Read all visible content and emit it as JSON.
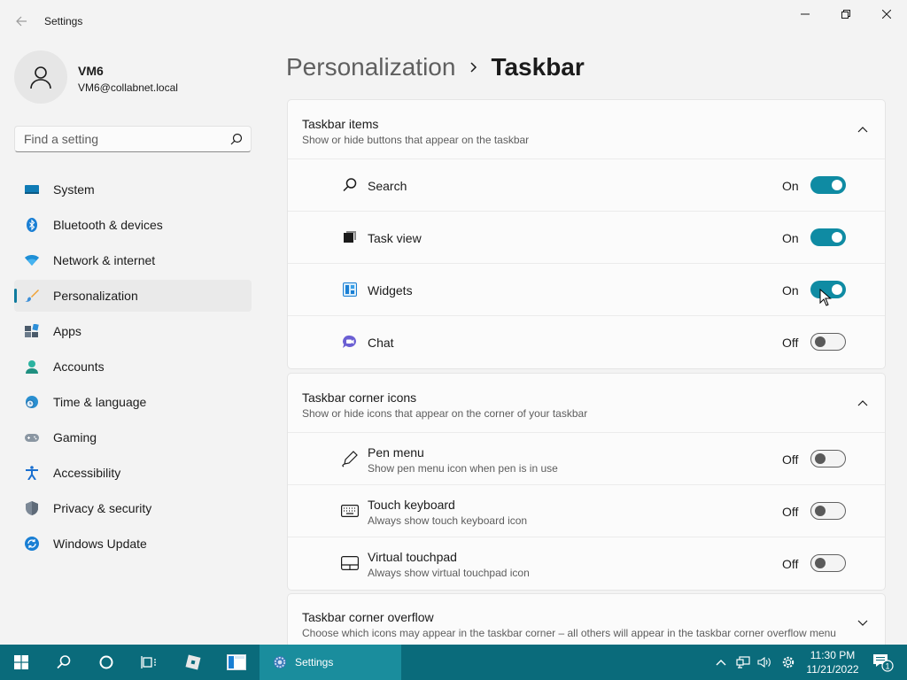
{
  "window": {
    "title": "Settings"
  },
  "user": {
    "name": "VM6",
    "email": "VM6@collabnet.local"
  },
  "search": {
    "placeholder": "Find a setting"
  },
  "nav": [
    {
      "label": "System",
      "icon": "monitor-icon"
    },
    {
      "label": "Bluetooth & devices",
      "icon": "bluetooth-icon"
    },
    {
      "label": "Network & internet",
      "icon": "wifi-icon"
    },
    {
      "label": "Personalization",
      "icon": "brush-icon",
      "active": true
    },
    {
      "label": "Apps",
      "icon": "apps-icon"
    },
    {
      "label": "Accounts",
      "icon": "person-icon"
    },
    {
      "label": "Time & language",
      "icon": "globe-clock-icon"
    },
    {
      "label": "Gaming",
      "icon": "gamepad-icon"
    },
    {
      "label": "Accessibility",
      "icon": "accessibility-icon"
    },
    {
      "label": "Privacy & security",
      "icon": "shield-icon"
    },
    {
      "label": "Windows Update",
      "icon": "update-icon"
    }
  ],
  "breadcrumb": {
    "parent": "Personalization",
    "current": "Taskbar"
  },
  "taskbar_items": {
    "title": "Taskbar items",
    "subtitle": "Show or hide buttons that appear on the taskbar",
    "rows": [
      {
        "label": "Search",
        "state": "On",
        "on": true,
        "icon": "search-icon"
      },
      {
        "label": "Task view",
        "state": "On",
        "on": true,
        "icon": "task-view-icon"
      },
      {
        "label": "Widgets",
        "state": "On",
        "on": true,
        "icon": "widgets-icon"
      },
      {
        "label": "Chat",
        "state": "Off",
        "on": false,
        "icon": "chat-icon"
      }
    ]
  },
  "corner_icons": {
    "title": "Taskbar corner icons",
    "subtitle": "Show or hide icons that appear on the corner of your taskbar",
    "rows": [
      {
        "label": "Pen menu",
        "sub": "Show pen menu icon when pen is in use",
        "state": "Off",
        "on": false,
        "icon": "pen-icon"
      },
      {
        "label": "Touch keyboard",
        "sub": "Always show touch keyboard icon",
        "state": "Off",
        "on": false,
        "icon": "keyboard-icon"
      },
      {
        "label": "Virtual touchpad",
        "sub": "Always show virtual touchpad icon",
        "state": "Off",
        "on": false,
        "icon": "touchpad-icon"
      }
    ]
  },
  "corner_overflow": {
    "title": "Taskbar corner overflow",
    "subtitle": "Choose which icons may appear in the taskbar corner – all others will appear in the taskbar corner overflow menu"
  },
  "taskbar": {
    "app_label": "Settings",
    "time": "11:30 PM",
    "date": "11/21/2022",
    "notification_count": "1"
  },
  "colors": {
    "accent": "#0f8ba3",
    "taskbar": "#0a6b7b",
    "taskbar_active": "#1a8d9d"
  }
}
